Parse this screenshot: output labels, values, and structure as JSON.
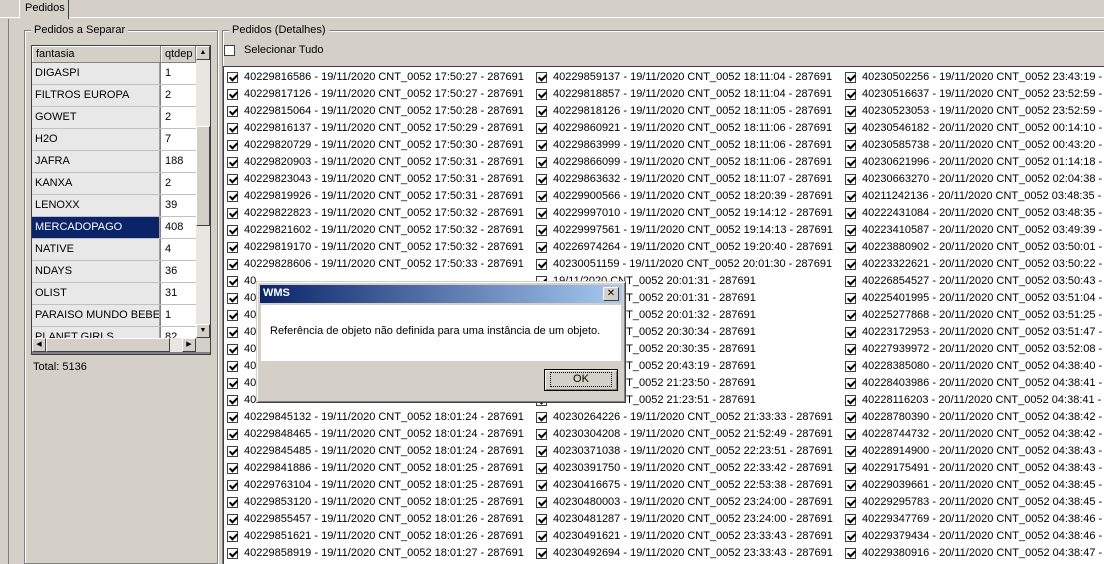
{
  "tabs": [
    {
      "label": "Pedidos"
    }
  ],
  "left_group": {
    "title": "Pedidos a Separar",
    "columns": [
      "fantasia",
      "qtdep"
    ],
    "rows": [
      {
        "fantasia": "DIGASPI",
        "qtd": "1"
      },
      {
        "fantasia": "FILTROS EUROPA",
        "qtd": "2"
      },
      {
        "fantasia": "GOWET",
        "qtd": "2"
      },
      {
        "fantasia": "H2O",
        "qtd": "7"
      },
      {
        "fantasia": "JAFRA",
        "qtd": "188"
      },
      {
        "fantasia": "KANXA",
        "qtd": "2"
      },
      {
        "fantasia": "LENOXX",
        "qtd": "39"
      },
      {
        "fantasia": "MERCADOPAGO",
        "qtd": "408",
        "selected": true
      },
      {
        "fantasia": "NATIVE",
        "qtd": "4"
      },
      {
        "fantasia": "NDAYS",
        "qtd": "36"
      },
      {
        "fantasia": "OLIST",
        "qtd": "31"
      },
      {
        "fantasia": "PARAISO MUNDO BEBE",
        "qtd": "1"
      },
      {
        "fantasia": "PLANET GIRLS",
        "qtd": "82"
      }
    ],
    "total": "Total: 5136"
  },
  "right_group": {
    "title": "Pedidos (Detalhes)",
    "select_all_label": "Selecionar Tudo",
    "columns": [
      [
        "40229816586 - 19/11/2020 CNT_0052 17:50:27 - 287691",
        "40229817126 - 19/11/2020 CNT_0052 17:50:27 - 287691",
        "40229815064 - 19/11/2020 CNT_0052 17:50:28 - 287691",
        "40229816137 - 19/11/2020 CNT_0052 17:50:29 - 287691",
        "40229820729 - 19/11/2020 CNT_0052 17:50:30 - 287691",
        "40229820903 - 19/11/2020 CNT_0052 17:50:31 - 287691",
        "40229823043 - 19/11/2020 CNT_0052 17:50:31 - 287691",
        "40229819926 - 19/11/2020 CNT_0052 17:50:31 - 287691",
        "40229822823 - 19/11/2020 CNT_0052 17:50:32 - 287691",
        "40229821602 - 19/11/2020 CNT_0052 17:50:32 - 287691",
        "40229819170 - 19/11/2020 CNT_0052 17:50:32 - 287691",
        "40229828606 - 19/11/2020 CNT_0052 17:50:33 - 287691",
        "40",
        "40",
        "40",
        "40",
        "40",
        "40",
        "40",
        "40",
        "40229845132 - 19/11/2020 CNT_0052 18:01:24 - 287691",
        "40229848465 - 19/11/2020 CNT_0052 18:01:24 - 287691",
        "40229845485 - 19/11/2020 CNT_0052 18:01:24 - 287691",
        "40229841886 - 19/11/2020 CNT_0052 18:01:25 - 287691",
        "40229763104 - 19/11/2020 CNT_0052 18:01:25 - 287691",
        "40229853120 - 19/11/2020 CNT_0052 18:01:25 - 287691",
        "40229855457 - 19/11/2020 CNT_0052 18:01:26 - 287691",
        "40229851621 - 19/11/2020 CNT_0052 18:01:26 - 287691",
        "40229858919 - 19/11/2020 CNT_0052 18:01:27 - 287691"
      ],
      [
        "40229859137 - 19/11/2020 CNT_0052 18:11:04 - 287691",
        "40229818857 - 19/11/2020 CNT_0052 18:11:04 - 287691",
        "40229818126 - 19/11/2020 CNT_0052 18:11:05 - 287691",
        "40229860921 - 19/11/2020 CNT_0052 18:11:06 - 287691",
        "40229863999 - 19/11/2020 CNT_0052 18:11:06 - 287691",
        "40229866099 - 19/11/2020 CNT_0052 18:11:06 - 287691",
        "40229863632 - 19/11/2020 CNT_0052 18:11:07 - 287691",
        "40229900566 - 19/11/2020 CNT_0052 18:20:39 - 287691",
        "40229997010 - 19/11/2020 CNT_0052 19:14:12 - 287691",
        "40229997561 - 19/11/2020 CNT_0052 19:14:13 - 287691",
        "40226974264 - 19/11/2020 CNT_0052 19:20:40 - 287691",
        "40230051159 - 19/11/2020 CNT_0052 20:01:30 - 287691",
        "19/11/2020 CNT_0052 20:01:31 - 287691",
        "19/11/2020 CNT_0052 20:01:31 - 287691",
        "19/11/2020 CNT_0052 20:01:32 - 287691",
        "19/11/2020 CNT_0052 20:30:34 - 287691",
        "19/11/2020 CNT_0052 20:30:35 - 287691",
        "19/11/2020 CNT_0052 20:43:19 - 287691",
        "19/11/2020 CNT_0052 21:23:50 - 287691",
        "19/11/2020 CNT_0052 21:23:51 - 287691",
        "40230264226 - 19/11/2020 CNT_0052 21:33:33 - 287691",
        "40230304208 - 19/11/2020 CNT_0052 21:52:49 - 287691",
        "40230371038 - 19/11/2020 CNT_0052 22:23:51 - 287691",
        "40230391750 - 19/11/2020 CNT_0052 22:33:42 - 287691",
        "40230416675 - 19/11/2020 CNT_0052 22:53:38 - 287691",
        "40230480003 - 19/11/2020 CNT_0052 23:24:00 - 287691",
        "40230481287 - 19/11/2020 CNT_0052 23:24:00 - 287691",
        "40230491621 - 19/11/2020 CNT_0052 23:33:43 - 287691",
        "40230492694 - 19/11/2020 CNT_0052 23:33:43 - 287691"
      ],
      [
        "40230502256 - 19/11/2020 CNT_0052 23:43:19 -",
        "40230516637 - 19/11/2020 CNT_0052 23:52:59 -",
        "40230523053 - 19/11/2020 CNT_0052 23:52:59 -",
        "40230546182 - 20/11/2020 CNT_0052 00:14:10 -",
        "40230585738 - 20/11/2020 CNT_0052 00:43:20 -",
        "40230621996 - 20/11/2020 CNT_0052 01:14:18 -",
        "40230663270 - 20/11/2020 CNT_0052 02:04:38 -",
        "40211242136 - 20/11/2020 CNT_0052 03:48:35 -",
        "40222431084 - 20/11/2020 CNT_0052 03:48:35 -",
        "40223410587 - 20/11/2020 CNT_0052 03:49:39 -",
        "40223880902 - 20/11/2020 CNT_0052 03:50:01 -",
        "40223322621 - 20/11/2020 CNT_0052 03:50:22 -",
        "40226854527 - 20/11/2020 CNT_0052 03:50:43 -",
        "40225401995 - 20/11/2020 CNT_0052 03:51:04 -",
        "40225277868 - 20/11/2020 CNT_0052 03:51:25 -",
        "40223172953 - 20/11/2020 CNT_0052 03:51:47 -",
        "40227939972 - 20/11/2020 CNT_0052 03:52:08 -",
        "40228385080 - 20/11/2020 CNT_0052 04:38:40 -",
        "40228403986 - 20/11/2020 CNT_0052 04:38:41 -",
        "40228116203 - 20/11/2020 CNT_0052 04:38:41 -",
        "40228780390 - 20/11/2020 CNT_0052 04:38:42 -",
        "40228744732 - 20/11/2020 CNT_0052 04:38:42 -",
        "40228914900 - 20/11/2020 CNT_0052 04:38:43 -",
        "40229175491 - 20/11/2020 CNT_0052 04:38:43 -",
        "40229039661 - 20/11/2020 CNT_0052 04:38:45 -",
        "40229295783 - 20/11/2020 CNT_0052 04:38:45 -",
        "40229347769 - 20/11/2020 CNT_0052 04:38:46 -",
        "40229379434 - 20/11/2020 CNT_0052 04:38:46 -",
        "40229380916 - 20/11/2020 CNT_0052 04:38:47 -"
      ]
    ]
  },
  "dialog": {
    "title": "WMS",
    "close": "✕",
    "message": "Referência de objeto não definida para uma instância de um objeto.",
    "ok_label": "OK"
  },
  "scroll_glyphs": {
    "up": "▲",
    "down": "▼",
    "left": "◀",
    "right": "▶"
  }
}
